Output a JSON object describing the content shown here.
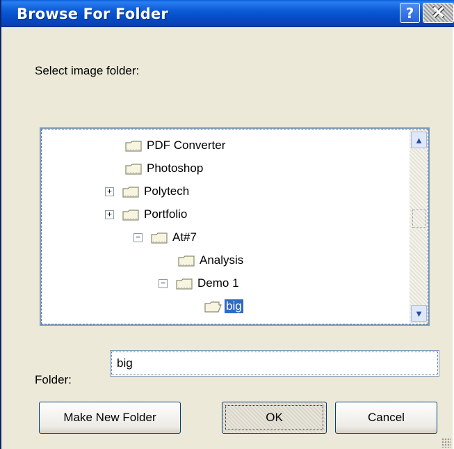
{
  "window": {
    "title": "Browse For Folder",
    "help_label": "?",
    "close_label": "✕"
  },
  "instruction": "Select image folder:",
  "tree": {
    "items": [
      {
        "label": "PDF Converter",
        "expander": "",
        "depth": 1
      },
      {
        "label": "Photoshop",
        "expander": "",
        "depth": 1
      },
      {
        "label": "Polytech",
        "expander": "+",
        "depth": 1
      },
      {
        "label": "Portfolio",
        "expander": "+",
        "depth": 1
      },
      {
        "label": "At#7",
        "expander": "−",
        "depth": 2
      },
      {
        "label": "Analysis",
        "expander": "",
        "depth": 3
      },
      {
        "label": "Demo 1",
        "expander": "−",
        "depth": 3
      },
      {
        "label": "big",
        "expander": "",
        "depth": 4,
        "selected": true
      }
    ],
    "scroll_up": "▲",
    "scroll_down": "▼"
  },
  "folder_field": {
    "label": "Folder:",
    "value": "big"
  },
  "buttons": {
    "make_new_folder": "Make New Folder",
    "ok": "OK",
    "cancel": "Cancel"
  },
  "colors": {
    "title_bar": "#0b5ad6",
    "selection": "#316ac5",
    "dialog_bg": "#ece9d8"
  }
}
